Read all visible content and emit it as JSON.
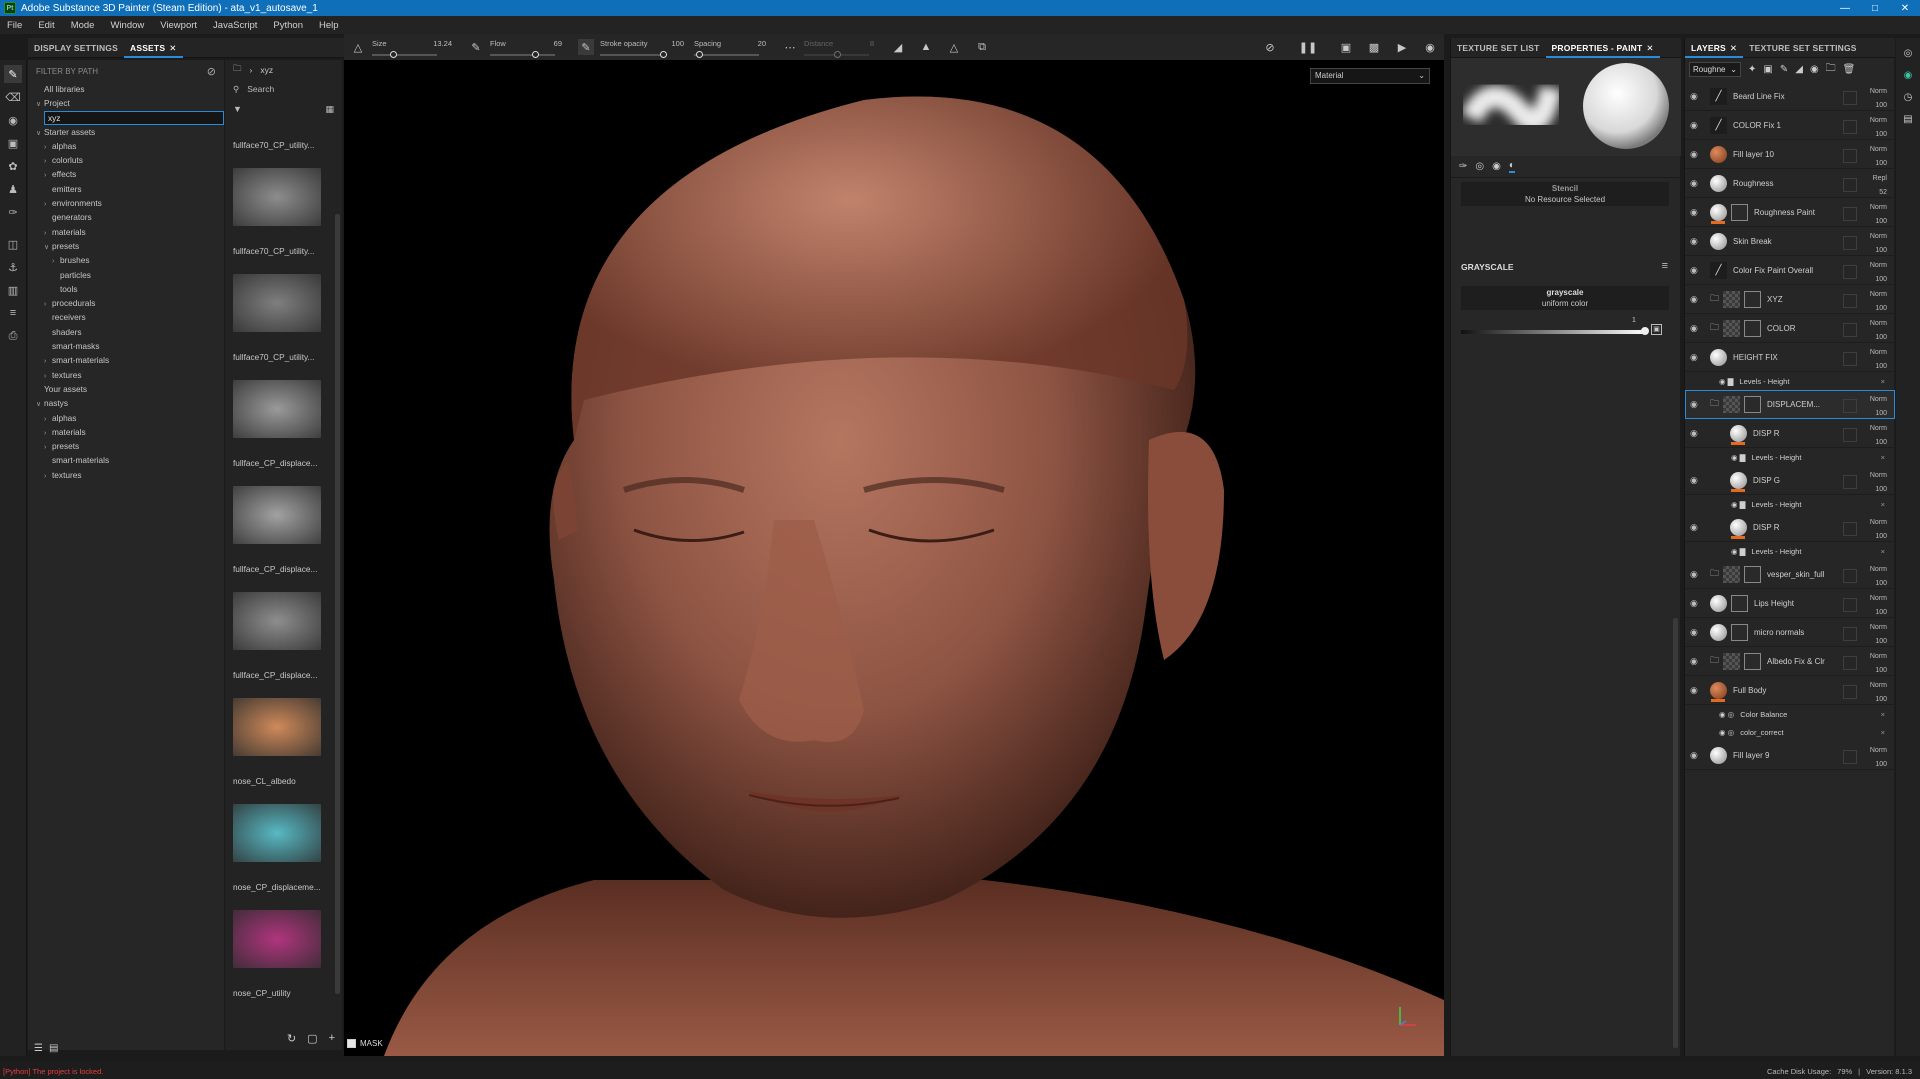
{
  "window": {
    "title": "Adobe Substance 3D Painter (Steam Edition) - ata_v1_autosave_1",
    "app_icon_text": "Pt"
  },
  "menu": [
    "File",
    "Edit",
    "Mode",
    "Window",
    "Viewport",
    "JavaScript",
    "Python",
    "Help"
  ],
  "assets_panel": {
    "tabs": [
      "DISPLAY SETTINGS",
      "ASSETS"
    ],
    "filter_placeholder": "FILTER BY PATH",
    "tree": [
      {
        "label": "All libraries",
        "indent": 0,
        "caret": ""
      },
      {
        "label": "Project",
        "indent": 0,
        "caret": "v"
      },
      {
        "label": "Starter assets",
        "indent": 0,
        "caret": "v"
      },
      {
        "label": "alphas",
        "indent": 1,
        "caret": ">"
      },
      {
        "label": "colorluts",
        "indent": 1,
        "caret": ">"
      },
      {
        "label": "effects",
        "indent": 1,
        "caret": ">"
      },
      {
        "label": "emitters",
        "indent": 1,
        "caret": ""
      },
      {
        "label": "environments",
        "indent": 1,
        "caret": ">"
      },
      {
        "label": "generators",
        "indent": 1,
        "caret": ""
      },
      {
        "label": "materials",
        "indent": 1,
        "caret": ">"
      },
      {
        "label": "presets",
        "indent": 1,
        "caret": "v"
      },
      {
        "label": "brushes",
        "indent": 2,
        "caret": ">"
      },
      {
        "label": "particles",
        "indent": 2,
        "caret": ""
      },
      {
        "label": "tools",
        "indent": 2,
        "caret": ""
      },
      {
        "label": "procedurals",
        "indent": 1,
        "caret": ">"
      },
      {
        "label": "receivers",
        "indent": 1,
        "caret": ""
      },
      {
        "label": "shaders",
        "indent": 1,
        "caret": ""
      },
      {
        "label": "smart-masks",
        "indent": 1,
        "caret": ""
      },
      {
        "label": "smart-materials",
        "indent": 1,
        "caret": ">"
      },
      {
        "label": "textures",
        "indent": 1,
        "caret": ">"
      },
      {
        "label": "Your assets",
        "indent": 0,
        "caret": ""
      },
      {
        "label": "nastys",
        "indent": 0,
        "caret": "v"
      },
      {
        "label": "alphas",
        "indent": 1,
        "caret": ">"
      },
      {
        "label": "materials",
        "indent": 1,
        "caret": ">"
      },
      {
        "label": "presets",
        "indent": 1,
        "caret": ">"
      },
      {
        "label": "smart-materials",
        "indent": 1,
        "caret": ""
      },
      {
        "label": "textures",
        "indent": 1,
        "caret": ">"
      }
    ],
    "project_input_value": "xyz"
  },
  "thumbs_panel": {
    "breadcrumb": "xyz",
    "search_placeholder": "Search",
    "items": [
      {
        "label": "fullface70_CP_utility...",
        "color": "#8d8d8d"
      },
      {
        "label": "fullface70_CP_utility...",
        "color": "#7f7f7f"
      },
      {
        "label": "fullface70_CP_utility...",
        "color": "#9a9a9a"
      },
      {
        "label": "fullface_CP_displace...",
        "color": "#a2a2a2"
      },
      {
        "label": "fullface_CP_displace...",
        "color": "#8e8e8e"
      },
      {
        "label": "fullface_CP_displace...",
        "color": "#cf8a5a"
      },
      {
        "label": "nose_CL_albedo",
        "color": "#58b9c4"
      },
      {
        "label": "nose_CP_displaceme...",
        "color": "#b0357e"
      },
      {
        "label": "nose_CP_utility",
        "color": "#6e6e6e"
      }
    ]
  },
  "viewport_toolbar": {
    "size": {
      "label": "Size",
      "value": "13.24"
    },
    "flow": {
      "label": "Flow",
      "value": "69"
    },
    "stroke_opacity": {
      "label": "Stroke opacity",
      "value": "100"
    },
    "spacing": {
      "label": "Spacing",
      "value": "20"
    },
    "distance": {
      "label": "Distance",
      "value": "8"
    }
  },
  "viewport": {
    "material_select": "Material",
    "mask_label": "MASK"
  },
  "properties": {
    "tabs": [
      "TEXTURE SET LIST",
      "PROPERTIES - PAINT"
    ],
    "stencil_title": "Stencil",
    "stencil_value": "No Resource Selected",
    "grayscale_section": "GRAYSCALE",
    "grayscale_name": "grayscale",
    "grayscale_sub": "uniform color",
    "grayscale_value": "1"
  },
  "layers": {
    "tabs": [
      "LAYERS",
      "TEXTURE SET SETTINGS"
    ],
    "channel": "Roughne",
    "rows": [
      {
        "name": "Beard Line Fix",
        "blend": "Norm",
        "opacity": "100",
        "icon": "brush"
      },
      {
        "name": "COLOR Fix 1",
        "blend": "Norm",
        "opacity": "100",
        "icon": "brush"
      },
      {
        "name": "Fill layer 10",
        "blend": "Norm",
        "opacity": "100",
        "icon": "ball-orange"
      },
      {
        "name": "Roughness",
        "blend": "Repl",
        "opacity": "52",
        "icon": "ball-white"
      },
      {
        "name": "Roughness Paint",
        "blend": "Norm",
        "opacity": "100",
        "icon": "ball-white"
      },
      {
        "name": "Skin Break",
        "blend": "Norm",
        "opacity": "100",
        "icon": "ball-white"
      },
      {
        "name": "Color Fix Paint Overall",
        "blend": "Norm",
        "opacity": "100",
        "icon": "brush"
      },
      {
        "name": "XYZ",
        "blend": "Norm",
        "opacity": "100",
        "icon": "folder"
      },
      {
        "name": "COLOR",
        "blend": "Norm",
        "opacity": "100",
        "icon": "folder"
      },
      {
        "name": "HEIGHT FIX",
        "blend": "Norm",
        "opacity": "100",
        "icon": "ball-white"
      },
      {
        "name": "DISPLACEM...",
        "blend": "Norm",
        "opacity": "100",
        "icon": "folder"
      },
      {
        "name": "DISP R",
        "blend": "Norm",
        "opacity": "100",
        "icon": "ball-white"
      },
      {
        "name": "DISP G",
        "blend": "Norm",
        "opacity": "100",
        "icon": "ball-white"
      },
      {
        "name": "DISP R",
        "blend": "Norm",
        "opacity": "100",
        "icon": "ball-white"
      },
      {
        "name": "vesper_skin_full",
        "blend": "Norm",
        "opacity": "100",
        "icon": "folder"
      },
      {
        "name": "Lips Height",
        "blend": "Norm",
        "opacity": "100",
        "icon": "ball-white"
      },
      {
        "name": "micro normals",
        "blend": "Norm",
        "opacity": "100",
        "icon": "ball-white"
      },
      {
        "name": "Albedo Fix & Clr",
        "blend": "Norm",
        "opacity": "100",
        "icon": "folder"
      },
      {
        "name": "Full Body",
        "blend": "Norm",
        "opacity": "100",
        "icon": "ball-orange"
      },
      {
        "name": "Fill layer 9",
        "blend": "Norm",
        "opacity": "100",
        "icon": "ball-white"
      }
    ],
    "effects": {
      "levels_height": "Levels - Height",
      "color_balance": "Color Balance",
      "color_correct": "color_correct"
    }
  },
  "status": {
    "error": "[Python] The project is locked.",
    "cache": "Cache Disk Usage:",
    "cache_value": "79%",
    "version": "Version: 8.1.3"
  },
  "colors": {
    "accent": "#2a8bd8",
    "title_bar": "#0f6fb8",
    "error": "#e24040",
    "orange_marker": "#e36a1f"
  }
}
